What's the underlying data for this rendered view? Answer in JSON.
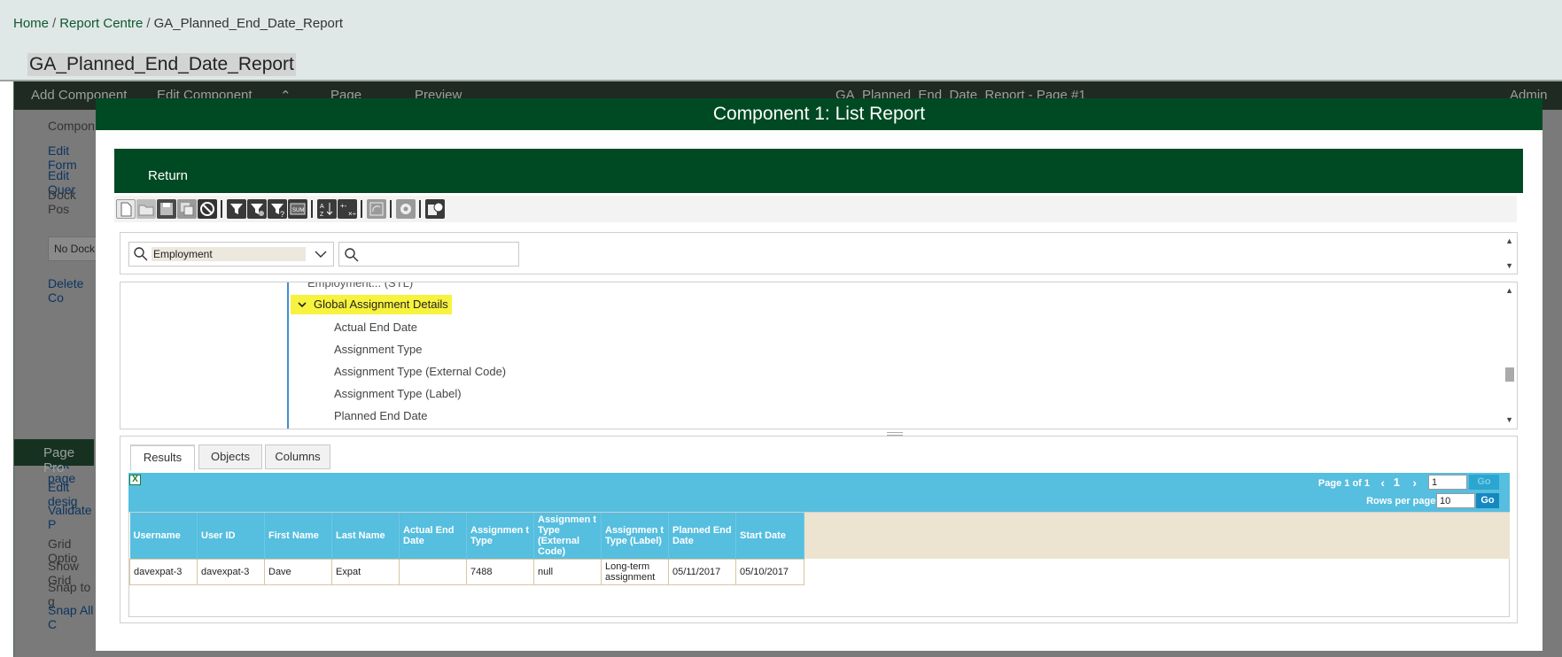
{
  "breadcrumb": {
    "home": "Home",
    "sep1": "/",
    "report_centre": "Report Centre",
    "sep2": "/",
    "current": "GA_Planned_End_Date_Report"
  },
  "page_title": "GA_Planned_End_Date_Report",
  "background_app": {
    "toolbar": {
      "add_component": "Add Component",
      "edit_component": "Edit Component",
      "page": "Page",
      "preview": "Preview",
      "page_title": "GA_Planned_End_Date_Report - Page #1",
      "admin": "Admin"
    },
    "left_menu": {
      "component": "Compon",
      "edit_format": "Edit Form",
      "edit_query": "Edit Quer",
      "dock_position": "Dock Pos",
      "dock_value": "No Dock",
      "delete": "Delete Co",
      "page_properties": "Page Pro",
      "edit_page": "Edit page",
      "edit_design": "Edit desig",
      "validate": "Validate P",
      "grid_options": "Grid Optio",
      "show_grid": "Show Grid",
      "snap_to_grid": "Snap to g",
      "snap_all": "Snap All C"
    }
  },
  "modal": {
    "title": "Component 1: List Report",
    "return_label": "Return",
    "toolbar_icons": [
      "new-icon",
      "open-icon",
      "save-icon",
      "save-as-icon",
      "cancel-icon",
      "filter-icon",
      "filter-edit-icon",
      "filter-help-icon",
      "formula-icon",
      "sort-icon",
      "calculation-icon",
      "refresh-icon",
      "settings-icon",
      "schedule-icon"
    ],
    "search": {
      "category_value": "Employment",
      "field_placeholder": ""
    },
    "tree": {
      "cut_item": "Employment... (STL)",
      "group": "Global Assignment Details",
      "items": [
        "Actual End Date",
        "Assignment Type",
        "Assignment Type (External Code)",
        "Assignment Type (Label)",
        "Planned End Date"
      ]
    },
    "results": {
      "tabs": [
        "Results",
        "Objects",
        "Columns"
      ],
      "pager": {
        "label": "Page 1 of 1",
        "current_page": "1",
        "page_input": "1",
        "go": "Go",
        "rows_label": "Rows per page:",
        "rows_value": "10",
        "go2": "Go"
      },
      "columns": [
        "Username",
        "User ID",
        "First Name",
        "Last Name",
        "Actual End Date",
        "Assignmen t Type",
        "Assignmen t Type (External Code)",
        "Assignmen t Type (Label)",
        "Planned End Date",
        "Start Date"
      ],
      "rows": [
        [
          "davexpat-3",
          "davexpat-3",
          "Dave",
          "Expat",
          "",
          "7488",
          "null",
          "Long-term assignment",
          "05/11/2017",
          "05/10/2017"
        ]
      ]
    }
  }
}
